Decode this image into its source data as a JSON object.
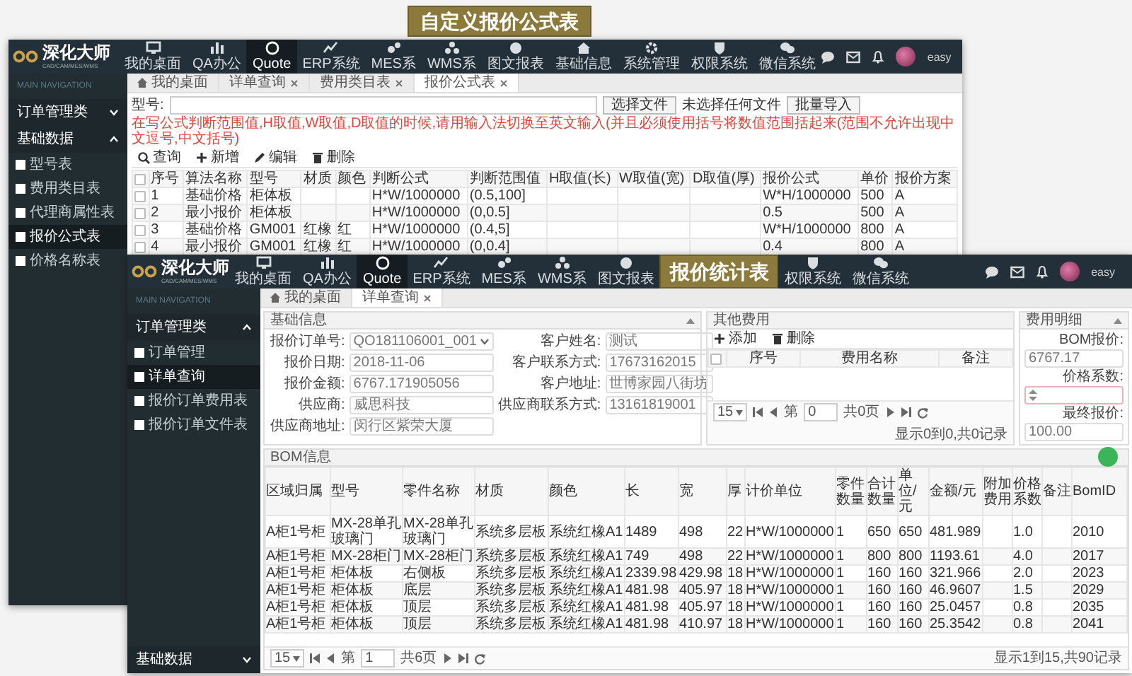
{
  "back_caption": "自定义报价公式表",
  "back_window": {
    "logo": {
      "name": "深化大师",
      "tagline": "CAD/CAM/MES/WMS"
    },
    "nav": [
      {
        "kind": "menu",
        "label": "我的桌面",
        "selected": false
      },
      {
        "kind": "menu",
        "label": "QA办公",
        "selected": false
      },
      {
        "kind": "menu",
        "label": "Quote",
        "selected": true
      },
      {
        "kind": "menu",
        "label": "ERP系统",
        "selected": false
      },
      {
        "kind": "menu",
        "label": "MES系",
        "selected": false
      },
      {
        "kind": "menu",
        "label": "WMS系",
        "selected": false
      },
      {
        "kind": "menu",
        "label": "图文报表",
        "selected": false
      },
      {
        "kind": "menu",
        "label": "基础信息",
        "selected": false
      },
      {
        "kind": "menu",
        "label": "系统管理",
        "selected": false
      },
      {
        "kind": "menu",
        "label": "权限系统",
        "selected": false
      },
      {
        "kind": "menu",
        "label": "微信系统",
        "selected": false
      }
    ],
    "user": "easy",
    "sidebar": {
      "heading": "MAIN NAVIGATION",
      "groups": [
        {
          "label": "订单管理类",
          "expanded": false
        },
        {
          "label": "基础数据",
          "expanded": true,
          "children": [
            {
              "label": "型号表",
              "selected": false
            },
            {
              "label": "费用类目表",
              "selected": false
            },
            {
              "label": "代理商属性表",
              "selected": false
            },
            {
              "label": "报价公式表",
              "selected": true
            },
            {
              "label": "价格名称表",
              "selected": false
            }
          ]
        }
      ]
    },
    "tabs": [
      {
        "label": "我的桌面",
        "closable": false,
        "selected": false
      },
      {
        "label": "详单查询",
        "closable": true,
        "selected": false
      },
      {
        "label": "费用类目表",
        "closable": true,
        "selected": false
      },
      {
        "label": "报价公式表",
        "closable": true,
        "selected": true
      }
    ],
    "toolbar": {
      "model_label": "型号:",
      "file_button": "选择文件",
      "file_status": "未选择任何文件",
      "import_button": "批量导入"
    },
    "notice": "在写公式判断范围值,H取值,W取值,D取值的时候,请用输入法切换至英文输入(并且必须使用括号将数值范围括起来(范围不允许出现中文逗号,中文括号)",
    "actions": [
      {
        "label": "查询"
      },
      {
        "label": "新增"
      },
      {
        "label": "编辑"
      },
      {
        "label": "删除"
      }
    ],
    "table": {
      "all_checked": false,
      "columns": [
        "序号",
        "算法名称",
        "型号",
        "材质",
        "颜色",
        "判断公式",
        "判断范围值",
        "H取值(长)",
        "W取值(宽)",
        "D取值(厚)",
        "报价公式",
        "单价",
        "报价方案"
      ],
      "rows": [
        {
          "checked": false,
          "cells": [
            "1",
            "基础价格",
            "柜体板",
            null,
            null,
            "H*W/1000000",
            "(0.5,100]",
            null,
            null,
            null,
            "W*H/1000000",
            "500",
            "A"
          ]
        },
        {
          "checked": false,
          "cells": [
            "2",
            "最小报价",
            "柜体板",
            null,
            null,
            "H*W/1000000",
            "(0,0.5]",
            null,
            null,
            null,
            "0.5",
            "500",
            "A"
          ]
        },
        {
          "checked": false,
          "cells": [
            "3",
            "基础价格",
            "GM001",
            "红橡",
            "红",
            "H*W/1000000",
            "(0.4,5]",
            null,
            null,
            null,
            "W*H/1000000",
            "800",
            "A"
          ]
        },
        {
          "checked": false,
          "cells": [
            "4",
            "最小报价",
            "GM001",
            "红橡",
            "红",
            "H*W/1000000",
            "(0,0.4]",
            null,
            null,
            null,
            "0.4",
            "800",
            "A"
          ]
        }
      ]
    }
  },
  "front_window": {
    "logo": {
      "name": "深化大师",
      "tagline": "CAD/CAM/MES/WMS"
    },
    "nav": [
      {
        "kind": "menu",
        "label": "我的桌面",
        "selected": false
      },
      {
        "kind": "menu",
        "label": "QA办公",
        "selected": false
      },
      {
        "kind": "menu",
        "label": "Quote",
        "selected": true
      },
      {
        "kind": "menu",
        "label": "ERP系统",
        "selected": false
      },
      {
        "kind": "menu",
        "label": "MES系",
        "selected": false
      },
      {
        "kind": "menu",
        "label": "WMS系",
        "selected": false
      },
      {
        "kind": "menu",
        "label": "图文报表",
        "selected": false
      },
      {
        "kind": "caption",
        "label": "报价统计表"
      },
      {
        "kind": "menu",
        "label": "权限系统",
        "selected": false
      },
      {
        "kind": "menu",
        "label": "微信系统",
        "selected": false
      }
    ],
    "user": "easy",
    "sidebar": {
      "heading": "MAIN NAVIGATION",
      "groups": [
        {
          "label": "订单管理类",
          "expanded": true,
          "children": [
            {
              "label": "订单管理",
              "selected": false
            },
            {
              "label": "详单查询",
              "selected": true
            },
            {
              "label": "报价订单费用表",
              "selected": false
            },
            {
              "label": "报价订单文件表",
              "selected": false
            }
          ]
        },
        {
          "label": "基础数据",
          "expanded": false
        }
      ]
    },
    "tabs": [
      {
        "label": "我的桌面",
        "closable": false,
        "selected": false
      },
      {
        "label": "详单查询",
        "closable": true,
        "selected": true
      }
    ],
    "basic_info": {
      "title": "基础信息",
      "fields": [
        {
          "label": "报价订单号:",
          "value": "QO181106001_001",
          "kind": "select"
        },
        {
          "label": "客户姓名:",
          "value": "测试",
          "kind": "text"
        },
        {
          "label": "报价日期:",
          "value": "2018-11-06",
          "kind": "text"
        },
        {
          "label": "客户联系方式:",
          "value": "17673162015",
          "kind": "text"
        },
        {
          "label": "报价金额:",
          "value": "6767.171905056",
          "kind": "text"
        },
        {
          "label": "客户地址:",
          "value": "世博家园八街坊",
          "kind": "text"
        },
        {
          "label": "供应商:",
          "value": "威思科技",
          "kind": "text"
        },
        {
          "label": "供应商联系方式:",
          "value": "13161819001",
          "kind": "text"
        },
        {
          "label": "供应商地址:",
          "value": "闵行区紫荣大厦",
          "kind": "text"
        }
      ]
    },
    "other_fees": {
      "title": "其他费用",
      "actions": [
        {
          "label": "添加"
        },
        {
          "label": "删除"
        }
      ],
      "all_checked": false,
      "columns": [
        "序号",
        "费用名称",
        "备注"
      ],
      "pager": {
        "page_size": "15",
        "page_prefix": "第",
        "page": "0",
        "page_total": "共0页",
        "summary": "显示0到0,共0记录"
      }
    },
    "fee_details": {
      "title": "费用明细",
      "fields": [
        {
          "label": "BOM报价:",
          "value": "6767.17",
          "kind": "text"
        },
        {
          "label": "价格系数:",
          "kind": "number"
        },
        {
          "label": "最终报价:",
          "value": "100.00",
          "kind": "text"
        }
      ]
    },
    "bom": {
      "title": "BOM信息",
      "columns": [
        "区域归属",
        "型号",
        "零件名称",
        "材质",
        "颜色",
        "长",
        "宽",
        "厚",
        "计价单位",
        "零件数量",
        "合计数量",
        "单位/元",
        "金额/元",
        "附加费用",
        "价格系数",
        "备注",
        "BomID"
      ],
      "rows": [
        [
          "A柜1号柜",
          "MX-28单孔玻璃门",
          "MX-28单孔玻璃门",
          "系统多层板",
          "系统红橡A1",
          "1489",
          "498",
          "22",
          "H*W/1000000",
          "1",
          "650",
          "650",
          "481.989",
          null,
          "1.0",
          null,
          "2010"
        ],
        [
          "A柜1号柜",
          "MX-28柜门",
          "MX-28柜门",
          "系统多层板",
          "系统红橡A1",
          "749",
          "498",
          "22",
          "H*W/1000000",
          "1",
          "800",
          "800",
          "1193.61",
          null,
          "4.0",
          null,
          "2017"
        ],
        [
          "A柜1号柜",
          "柜体板",
          "右侧板",
          "系统多层板",
          "系统红橡A1",
          "2339.98",
          "429.98",
          "18",
          "H*W/1000000",
          "1",
          "160",
          "160",
          "321.966",
          null,
          "2.0",
          null,
          "2023"
        ],
        [
          "A柜1号柜",
          "柜体板",
          "底层",
          "系统多层板",
          "系统红橡A1",
          "481.98",
          "405.97",
          "18",
          "H*W/1000000",
          "1",
          "160",
          "160",
          "46.9607",
          null,
          "1.5",
          null,
          "2029"
        ],
        [
          "A柜1号柜",
          "柜体板",
          "顶层",
          "系统多层板",
          "系统红橡A1",
          "481.98",
          "405.97",
          "18",
          "H*W/1000000",
          "1",
          "160",
          "160",
          "25.0457",
          null,
          "0.8",
          null,
          "2035"
        ],
        [
          "A柜1号柜",
          "柜体板",
          "顶层",
          "系统多层板",
          "系统红橡A1",
          "481.98",
          "410.97",
          "18",
          "H*W/1000000",
          "1",
          "160",
          "160",
          "25.3542",
          null,
          "0.8",
          null,
          "2041"
        ]
      ],
      "pager": {
        "page_size": "15",
        "page_prefix": "第",
        "page": "1",
        "page_total": "共6页",
        "summary": "显示1到15,共90记录"
      }
    }
  }
}
